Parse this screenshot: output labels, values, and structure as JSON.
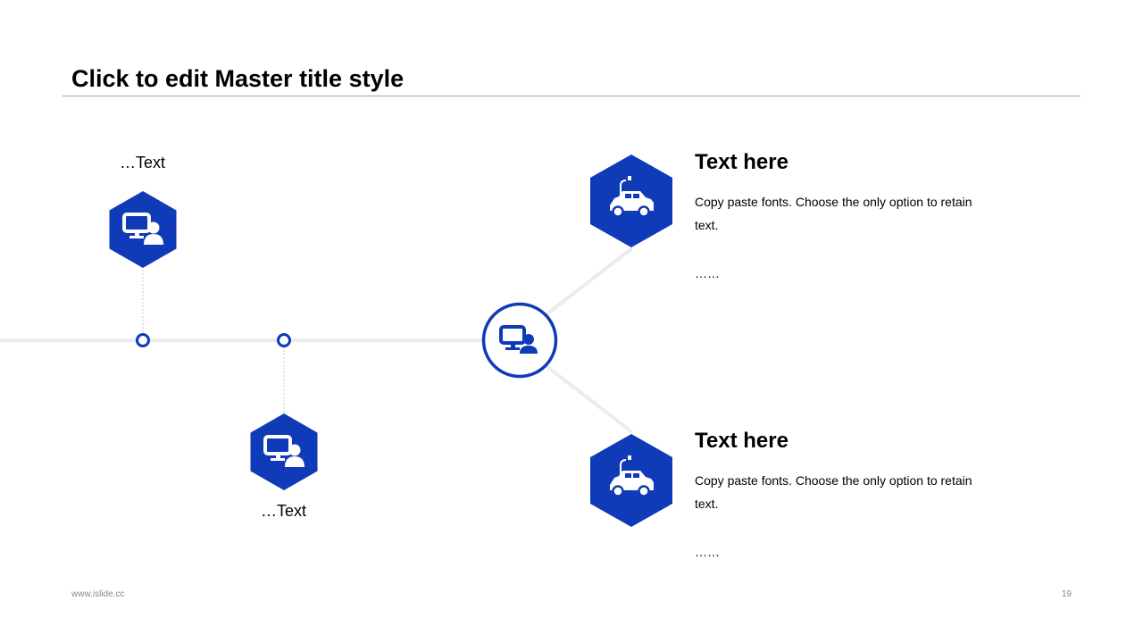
{
  "slide": {
    "title": "Click to edit Master title style"
  },
  "timeline": {
    "top_node": {
      "label": "…Text",
      "icon": "computer-user-icon"
    },
    "bottom_node": {
      "label": "…Text",
      "icon": "computer-user-icon"
    },
    "hub_icon": "computer-user-icon"
  },
  "items": [
    {
      "heading": "Text here",
      "body": "Copy paste fonts. Choose the only option to retain text.",
      "more": "……",
      "icon": "electric-car-icon"
    },
    {
      "heading": "Text here",
      "body": "Copy paste fonts. Choose the only option to retain text.",
      "more": "……",
      "icon": "electric-car-icon"
    }
  ],
  "footer": {
    "website": "www.islide.cc",
    "page_number": "19"
  },
  "colors": {
    "accent": "#0f3ab8",
    "line": "#ececec",
    "connector": "#c8c8c8"
  }
}
